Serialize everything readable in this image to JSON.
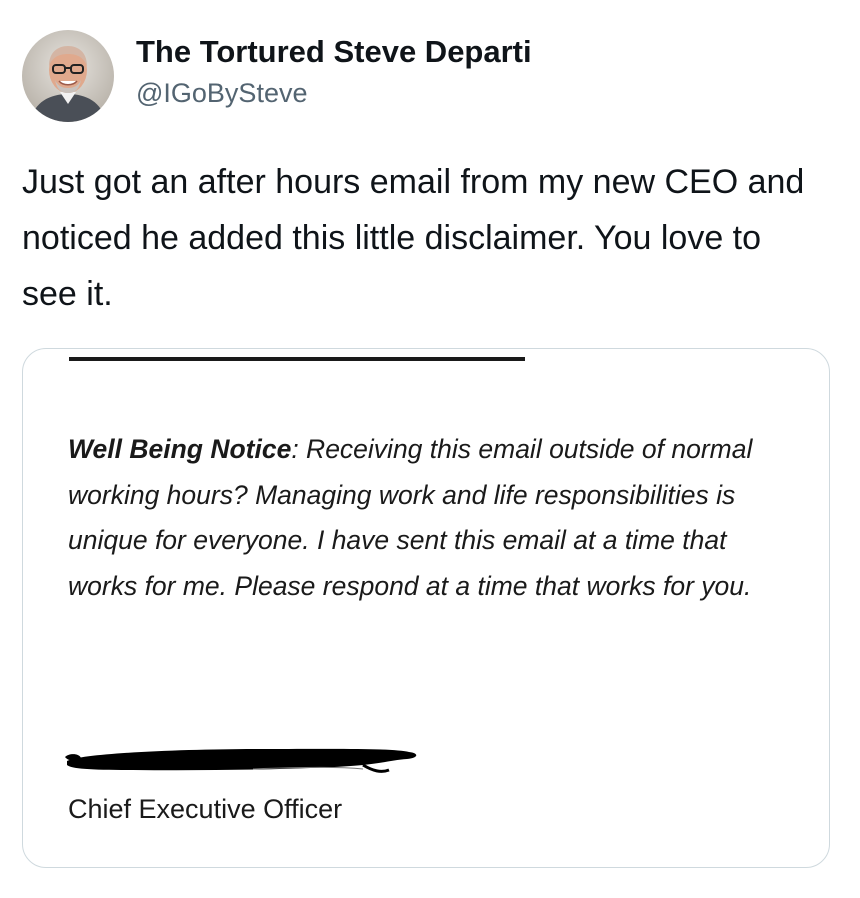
{
  "author": {
    "display_name": "The Tortured Steve Departi",
    "handle": "@IGoBySteve"
  },
  "tweet": {
    "text": "Just got an after hours email from my new CEO and noticed he added this little disclaimer. You love to see it."
  },
  "email": {
    "notice_label": "Well Being Notice",
    "notice_text": ": Receiving this email outside of normal working hours?  Managing work and life responsibilities is unique for everyone.  I have sent this email at a time that works for me.  Please respond at a time that works for you.",
    "signature_title": "Chief Executive Officer"
  },
  "colors": {
    "text": "#0f1419",
    "handle": "#536471",
    "card_border": "#cfd9de",
    "redaction": "#000000"
  },
  "icons": {
    "avatar": "profile-photo",
    "redaction": "black-marker-redaction"
  }
}
